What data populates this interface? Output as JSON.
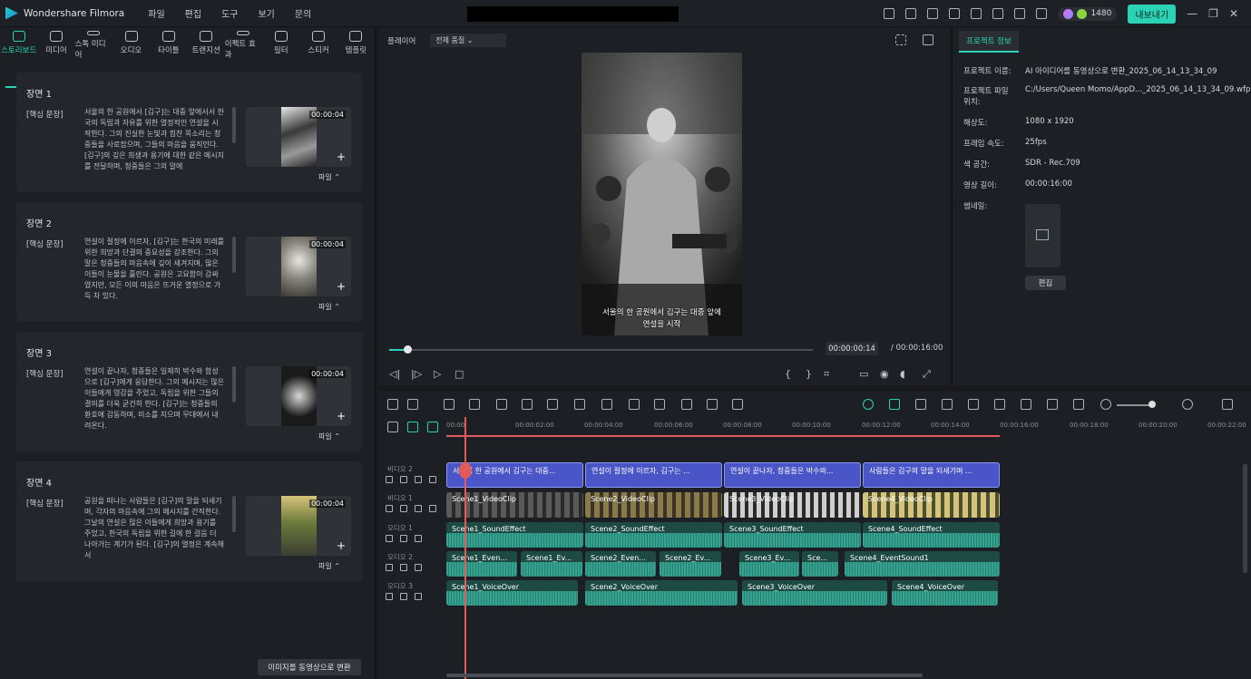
{
  "app": {
    "title": "Wondershare Filmora"
  },
  "menu": [
    "파일",
    "편집",
    "도구",
    "보기",
    "문의"
  ],
  "credits": "1480",
  "export_label": "내보내기",
  "left_tools": [
    "스토리보드",
    "미디어",
    "스톡 미디어",
    "오디오",
    "타이틀",
    "트랜지션",
    "이펙트 효과",
    "필터",
    "스티커",
    "템플릿"
  ],
  "scenes": [
    {
      "title": "장면 1",
      "tag": "[핵심 문장]",
      "body": "서울의 한 공원에서 [김구]는 대중 앞에서서 한국의 독립과 자유를 위한 열정적인 연설을 시작한다. 그의 진실한 눈빛과 힘찬 목소리는 청중들을 사로잡으며, 그들의 마음을 움직인다. [김구]의 깊은 희생과 용기에 대한 같은 메시지를 전달하며, 청중들은 그의 말에",
      "duration": "00:00:04",
      "file": "파일"
    },
    {
      "title": "장면 2",
      "tag": "[핵심 문장]",
      "body": "연설이 절정에 이르자, [김구]는 한국의 미래를 위한 희망과 단결의 중요성을 강조한다. 그의 말은 청중들의 마음속에 깊이 새겨지며, 많은 이들이 눈물을 흘린다. 공원은 고요함이 감싸였지만, 모든 이의 마음은 뜨거운 열정으로 가득 차 있다.",
      "duration": "00:00:04",
      "file": "파일"
    },
    {
      "title": "장면 3",
      "tag": "[핵심 문장]",
      "body": "연설이 끝나자, 청중들은 일제히 박수와 함성으로 [김구]에게 응답한다. 그의 메시지는 많은 이들에게 영감을 주었고, 독립을 위한 그들의 결의를 더욱 굳건히 한다. [김구]는 청중들의 환호에 감동하며, 미소를 지으며 무대에서 내려온다.",
      "duration": "00:00:04",
      "file": "파일"
    },
    {
      "title": "장면 4",
      "tag": "[핵심 문장]",
      "body": "공원을 떠나는 사람들은 [김구]의 말을 되새기며, 각자의 마음속에 그의 메시지를 간직한다. 그날의 연설은 많은 이들에게 희망과 용기를 주었고, 한국의 독립을 위한 길에 한 걸음 더 나아가는 계기가 된다. [김구]의 열정은 계속해서",
      "duration": "00:00:04",
      "file": "파일"
    }
  ],
  "convert_label": "이미지를 동영상으로 변환",
  "player": {
    "label": "플레이어",
    "quality": "전체 품질",
    "subtitle_line1": "서울의 한 공원에서 김구는 대중 앞에",
    "subtitle_line2": "연설을 시작",
    "current_time": "00:00:00:14",
    "total_time": "/ 00:00:16:00"
  },
  "project_info": {
    "tab": "프로젝트 정보",
    "rows": [
      {
        "label": "프로젝트 이름:",
        "value": "AI 아이디어를 동영상으로 변환_2025_06_14_13_34_09"
      },
      {
        "label": "프로젝트 파일 위치:",
        "value": "C:/Users/Queen Momo/AppD..._2025_06_14_13_34_09.wfp"
      },
      {
        "label": "해상도:",
        "value": "1080 x 1920"
      },
      {
        "label": "프레임 속도:",
        "value": "25fps"
      },
      {
        "label": "색 공간:",
        "value": "SDR - Rec.709"
      },
      {
        "label": "영상 길이:",
        "value": "00:00:16:00"
      },
      {
        "label": "썸네일:",
        "value": ""
      }
    ],
    "edit_label": "편집"
  },
  "ruler_ticks": [
    "00:00",
    "00:00:02:00",
    "00:00:04:00",
    "00:00:06:00",
    "00:00:08:00",
    "00:00:10:00",
    "00:00:12:00",
    "00:00:14:00",
    "00:00:16:00",
    "00:00:18:00",
    "00:00:20:00",
    "00:00:22:00"
  ],
  "tracks": [
    {
      "name": "비디오 2"
    },
    {
      "name": "비디오 1"
    },
    {
      "name": "오디오 1"
    },
    {
      "name": "오디오 2"
    },
    {
      "name": "오디오 3"
    }
  ],
  "clips": {
    "text": [
      "서울의 한 공원에서 김구는 대중...",
      "연설이 절정에 이르자, 김구는 ...",
      "연설이 끝나자, 청중들은 박수와...",
      "사람들은 김구의 말을 되새기며 ..."
    ],
    "video": [
      "Scene1_VideoClip",
      "Scene2_VideoClip",
      "Scene3_VideoClip",
      "Scene4_VideoClip"
    ],
    "sound": [
      "Scene1_SoundEffect",
      "Scene2_SoundEffect",
      "Scene3_SoundEffect",
      "Scene4_SoundEffect"
    ],
    "event": [
      "Scene1_Even...",
      "Scene1_Ev...",
      "Scene2_Even...",
      "Scene2_Ev...",
      "Scene3_Ev...",
      "Sce...",
      "Scene4_EventSound1"
    ],
    "voice": [
      "Scene1_VoiceOver",
      "Scene2_VoiceOver",
      "Scene3_VoiceOver",
      "Scene4_VoiceOver"
    ]
  }
}
